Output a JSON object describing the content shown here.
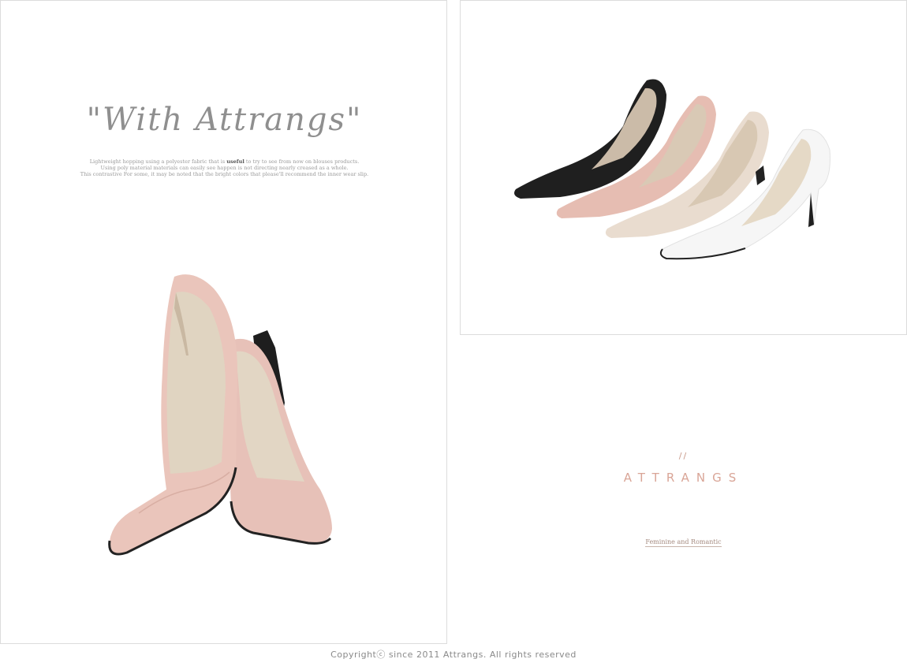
{
  "banner": {
    "script_title": "\"With Attrangs\"",
    "description_lines": [
      "Lightweight hopping using a polyester fabric that is useful to try to see from now on blouses products.",
      "Using poly material materials can easily see happen is not directing nearly creased as a whole.",
      "This contrastive For some, it may be noted that the bright colors that please'll recommend the inner wear slip."
    ],
    "bold_word": "useful"
  },
  "images": {
    "pink_pair_icon": "pink-pointed-pumps-pair",
    "color_row_icon": "pointed-pumps-four-colors"
  },
  "colors": {
    "pink": "#e8c0b6",
    "black": "#1e1e1e",
    "beige": "#e8dccf",
    "white": "#f7f7f7",
    "accent": "#d9a597"
  },
  "brand": {
    "slashes": "//",
    "name": "ATTRANGS",
    "tagline": "Feminine and Romantic"
  },
  "footer": {
    "copyright": "Copyrightⓒ since 2011 Attrangs. All rights reserved"
  }
}
